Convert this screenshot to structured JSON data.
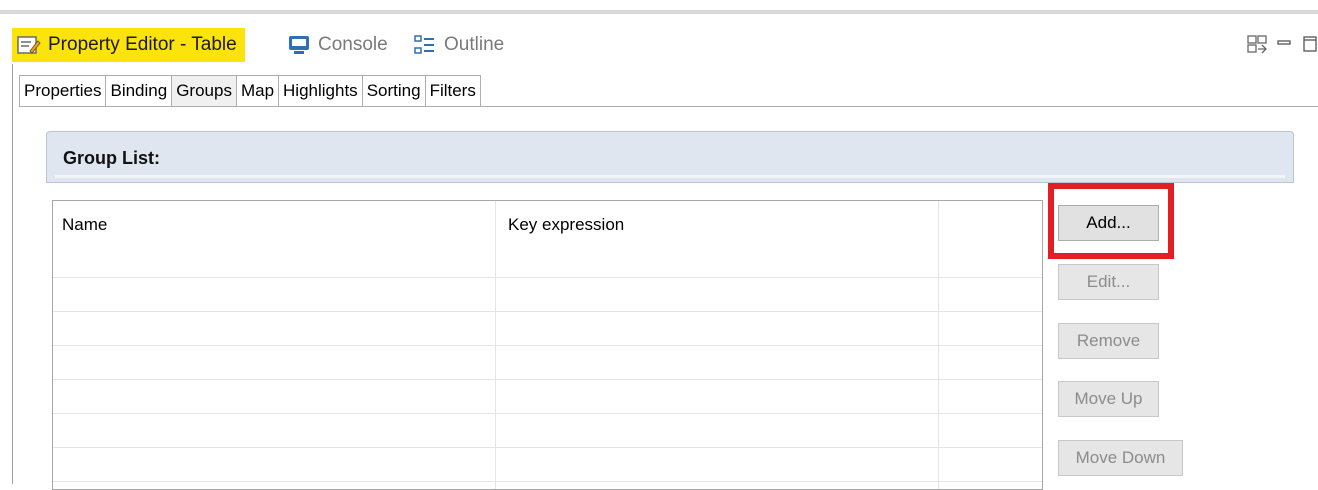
{
  "view_tabs": {
    "property_editor": "Property Editor - Table",
    "console": "Console",
    "outline": "Outline"
  },
  "icons": {
    "property_editor": "property-editor-icon",
    "console": "console-icon",
    "outline": "outline-icon",
    "view_menu": "view-menu-icon",
    "minimize": "minimize-icon",
    "maximize": "maximize-icon"
  },
  "colors": {
    "active_tab_highlight": "#fde30c",
    "annotation_box": "#e41e25",
    "section_header": "#dfe6ef"
  },
  "editor_tabs": [
    "Properties",
    "Binding",
    "Groups",
    "Map",
    "Highlights",
    "Sorting",
    "Filters"
  ],
  "active_editor_tab": "Groups",
  "section": {
    "title": "Group List:"
  },
  "table": {
    "columns": [
      "Name",
      "Key expression",
      ""
    ],
    "rows": []
  },
  "buttons": {
    "add": "Add...",
    "edit": "Edit...",
    "remove": "Remove",
    "move_up": "Move Up",
    "move_down": "Move Down"
  }
}
